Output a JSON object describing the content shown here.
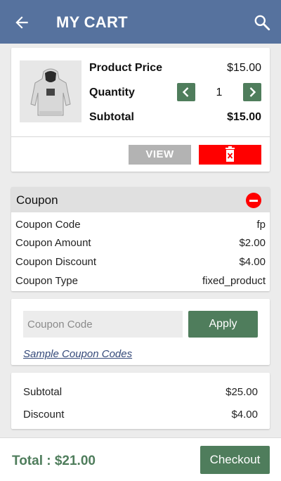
{
  "app_bar": {
    "title": "MY CART",
    "back_icon": "arrow-left-icon",
    "search_icon": "search-icon",
    "color": "#56729e"
  },
  "product": {
    "image_icon": "hoodie-product-image",
    "price_label": "Product Price",
    "price_value": "$15.00",
    "quantity_label": "Quantity",
    "quantity_value": "1",
    "subtotal_label": "Subtotal",
    "subtotal_value": "$15.00",
    "view_label": "VIEW",
    "delete_icon": "trash-icon"
  },
  "coupon": {
    "title": "Coupon",
    "remove_icon": "minus-circle-icon",
    "rows": [
      {
        "label": "Coupon Code",
        "value": "fp"
      },
      {
        "label": "Coupon Amount",
        "value": "$2.00"
      },
      {
        "label": "Coupon Discount",
        "value": "$4.00"
      },
      {
        "label": "Coupon Type",
        "value": "fixed_product"
      }
    ]
  },
  "apply": {
    "input_placeholder": "Coupon Code",
    "input_value": "",
    "button_label": "Apply",
    "sample_link": "Sample Coupon Codes"
  },
  "summary": {
    "subtotal_label": "Subtotal",
    "subtotal_value": "$25.00",
    "discount_label": "Discount",
    "discount_value": "$4.00"
  },
  "footer": {
    "total": "Total : $21.00",
    "checkout_label": "Checkout"
  },
  "colors": {
    "accent": "#4f7d5c",
    "danger": "#ff0000",
    "view_button": "#b3b3b3"
  }
}
